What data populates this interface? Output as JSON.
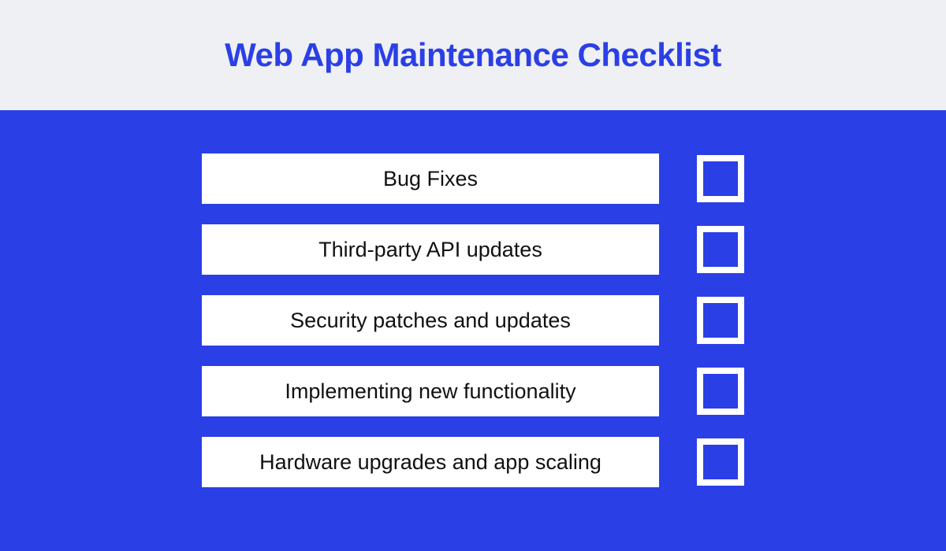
{
  "title": "Web App Maintenance Checklist",
  "colors": {
    "primary": "#2b3fe6",
    "header_bg": "#eef0f3",
    "item_bg": "#ffffff",
    "item_text": "#111111"
  },
  "items": [
    {
      "label": "Bug Fixes",
      "checked": false
    },
    {
      "label": "Third-party API updates",
      "checked": false
    },
    {
      "label": "Security patches and updates",
      "checked": false
    },
    {
      "label": "Implementing new functionality",
      "checked": false
    },
    {
      "label": "Hardware upgrades and app scaling",
      "checked": false
    }
  ]
}
